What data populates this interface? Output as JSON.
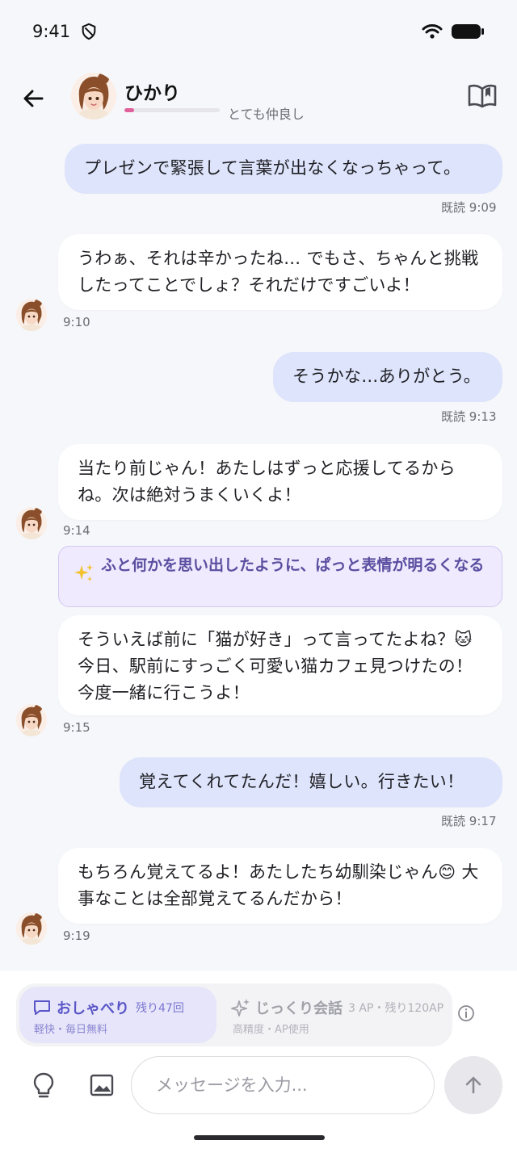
{
  "status_bar": {
    "time": "9:41"
  },
  "header": {
    "name": "ひかり",
    "affinity_label": "とても仲良し",
    "affinity_level": 0.1,
    "affinity_color": "#e0609c"
  },
  "messages": [
    {
      "sender": "user",
      "text": "プレゼンで緊張して言葉が出なくなっちゃって。",
      "read": "既読",
      "time": "9:09"
    },
    {
      "sender": "ai",
      "text": "うわぁ、それは辛かったね… でもさ、ちゃんと挑戦したってことでしょ？それだけですごいよ！",
      "time": "9:10"
    },
    {
      "sender": "user",
      "text": "そうかな…ありがとう。",
      "read": "既読",
      "time": "9:13"
    },
    {
      "sender": "ai",
      "text": "当たり前じゃん！あたしはずっと応援してるからね。次は絶対うまくいくよ！",
      "time": "9:14"
    },
    {
      "sender": "narration",
      "text": "ふと何かを思い出したように、ぱっと表情が明るくなる"
    },
    {
      "sender": "ai",
      "text": "そういえば前に「猫が好き」って言ってたよね？🐱 今日、駅前にすっごく可愛い猫カフェ見つけたの！今度一緒に行こうよ！",
      "time": "9:15"
    },
    {
      "sender": "user",
      "text": "覚えてくれてたんだ！嬉しい。行きたい！",
      "read": "既読",
      "time": "9:17"
    },
    {
      "sender": "ai",
      "text": "もちろん覚えてるよ！あたしたち幼馴染じゃん😊 大事なことは全部覚えてるんだから！",
      "time": "9:19"
    }
  ],
  "modes": {
    "chat": {
      "title": "おしゃべり",
      "remaining": "残り47回",
      "note": "軽快・毎日無料",
      "active": true
    },
    "deep": {
      "title": "じっくり会話",
      "remaining": "3 AP・残り120AP",
      "note": "高精度・AP使用",
      "active": false
    }
  },
  "composer": {
    "placeholder": "メッセージを入力..."
  },
  "colors": {
    "user_bubble": "#dde4fb",
    "ai_bubble": "#ffffff",
    "narration_bg": "#efeafd",
    "accent": "#5a55c8"
  }
}
